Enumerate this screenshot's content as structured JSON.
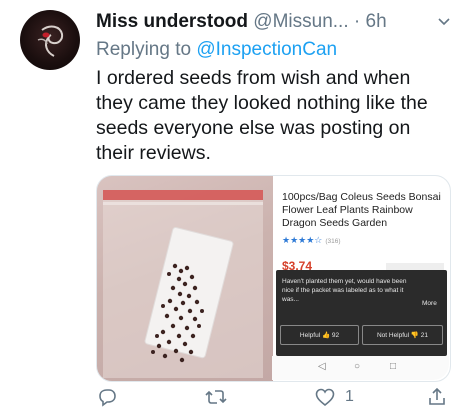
{
  "tweet": {
    "display_name": "Miss understood",
    "handle": "@Missun...",
    "separator": " · ",
    "time": "6h",
    "replying_prefix": "Replying to ",
    "replying_to": "@InspectionCan",
    "text": "I ordered seeds from wish and when they came they looked nothing like the seeds everyone else was posting on their reviews."
  },
  "screenshot": {
    "product_title": "100pcs/Bag Coleus Seeds Bonsai Flower Leaf Plants Rainbow Dragon Seeds Garden",
    "stars": "★★★★☆",
    "rating_count": "(316)",
    "price": "$3.74",
    "review_text": "Haven't planted them yet, would have been nice if the packet was labeled as to what it was...",
    "review_more": "More",
    "helpful_label": "Helpful 👍 92",
    "not_helpful_label": "Not Helpful 👎 21",
    "nav_back": "◁",
    "nav_home": "○",
    "nav_recent": "□"
  },
  "actions": {
    "reply_icon": "reply-icon",
    "retweet_icon": "retweet-icon",
    "like_icon": "like-icon",
    "like_count": "1",
    "share_icon": "share-icon"
  },
  "colors": {
    "accent": "#1da1f2",
    "muted": "#657786",
    "text": "#14171a"
  }
}
